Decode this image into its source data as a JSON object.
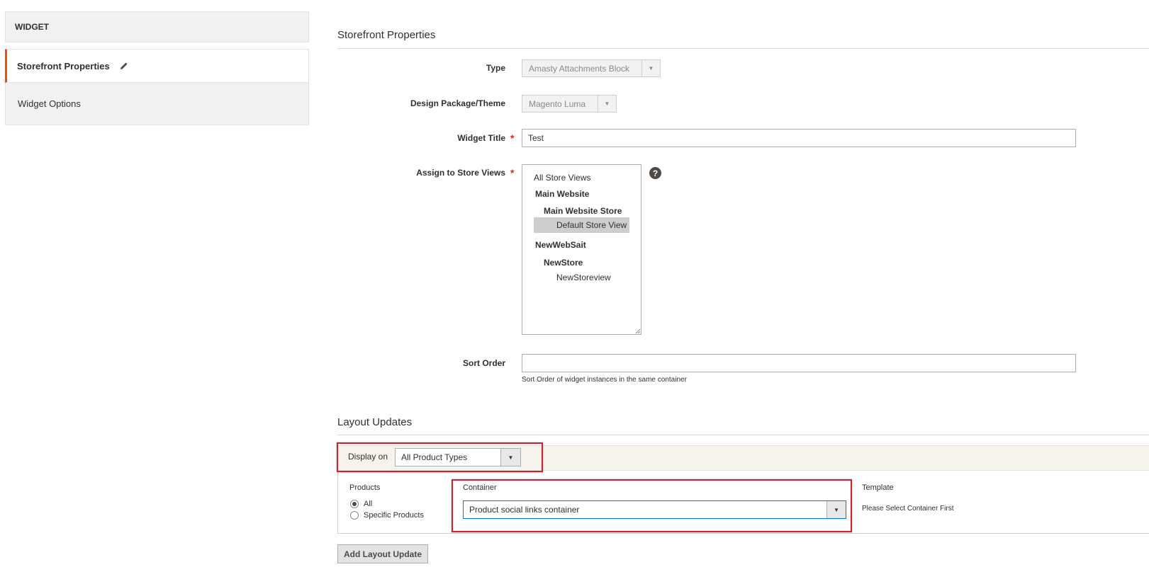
{
  "sidebar": {
    "header": "WIDGET",
    "items": [
      {
        "label": "Storefront Properties",
        "active": true
      },
      {
        "label": "Widget Options",
        "active": false
      }
    ]
  },
  "storefront": {
    "title": "Storefront Properties",
    "type": {
      "label": "Type",
      "value": "Amasty Attachments Block"
    },
    "theme": {
      "label": "Design Package/Theme",
      "value": "Magento Luma"
    },
    "widget_title": {
      "label": "Widget Title",
      "value": "Test"
    },
    "store_views": {
      "label": "Assign to Store Views",
      "options": [
        {
          "label": "All Store Views"
        },
        {
          "label": "Main Website"
        },
        {
          "label": "Main Website Store"
        },
        {
          "label": "Default Store View",
          "selected": true
        },
        {
          "label": "NewWebSait"
        },
        {
          "label": "NewStore"
        },
        {
          "label": "NewStoreview"
        }
      ],
      "help": "?"
    },
    "sort_order": {
      "label": "Sort Order",
      "value": "",
      "note": "Sort Order of widget instances in the same container"
    }
  },
  "layout_updates": {
    "title": "Layout Updates",
    "display_on": {
      "label": "Display on",
      "value": "All Product Types"
    },
    "products": {
      "header": "Products",
      "all": "All",
      "specific": "Specific Products",
      "selected": "all"
    },
    "container": {
      "header": "Container",
      "value": "Product social links container"
    },
    "template": {
      "header": "Template",
      "note": "Please Select Container First"
    },
    "add_button": "Add Layout Update"
  },
  "colors": {
    "accent": "#eb5202",
    "required": "#e22626",
    "highlight": "#d3202a",
    "focus": "#007bdb"
  }
}
